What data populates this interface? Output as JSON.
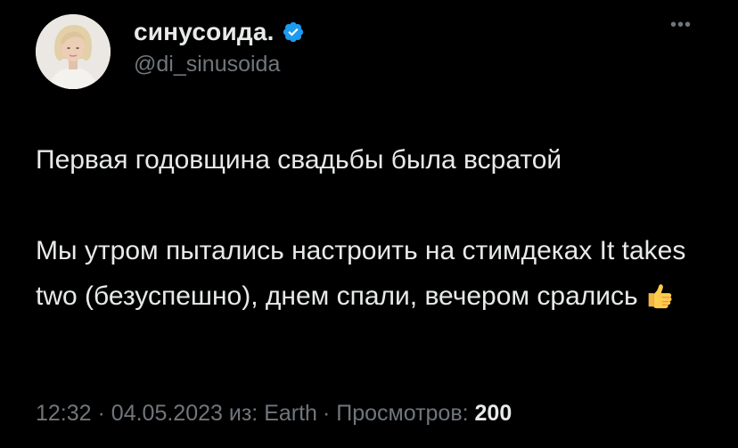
{
  "author": {
    "display_name": "синусоида.",
    "handle": "@di_sinusoida",
    "verified": true
  },
  "tweet": {
    "line1": "Первая годовщина свадьбы была всратой",
    "line2": "Мы утром пытались настроить на стимдеках It takes two (безуспешно), днем спали, вечером срались",
    "emoji": "thumbs-up-icon"
  },
  "meta": {
    "time": "12:32",
    "date": "04.05.2023",
    "source_prefix": "из:",
    "source": "Earth",
    "views_label": "Просмотров:",
    "views_count": "200",
    "separator": "·"
  },
  "icons": {
    "more": "more-options-icon",
    "verified": "verified-badge-icon"
  },
  "colors": {
    "background": "#000000",
    "text_primary": "#e7e9ea",
    "text_secondary": "#71767b",
    "verified_blue": "#1d9bf0"
  }
}
